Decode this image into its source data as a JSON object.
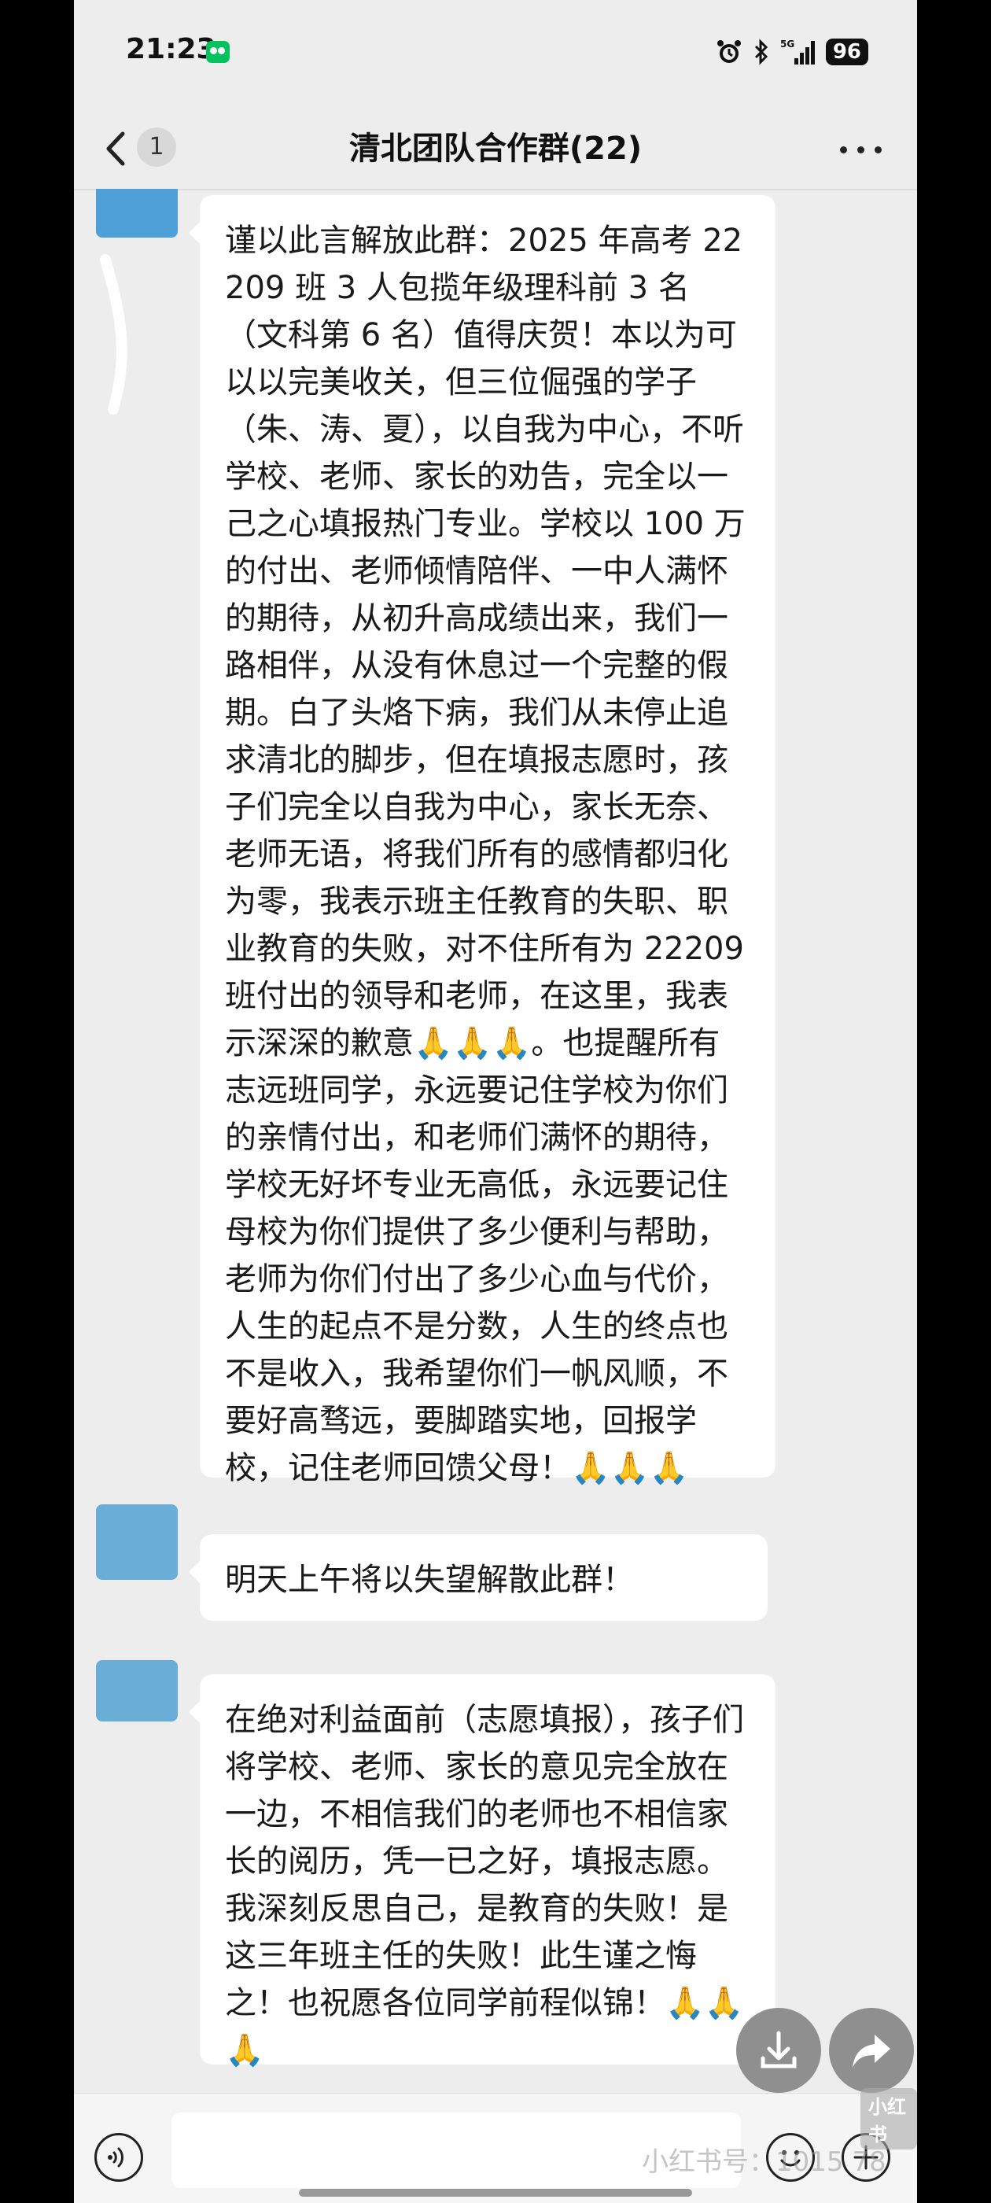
{
  "status_bar": {
    "time": "21:23",
    "network": "5G",
    "battery": "96",
    "icons": [
      "wechat-icon",
      "alarm-icon",
      "bluetooth-icon",
      "signal-icon",
      "battery-icon"
    ]
  },
  "nav": {
    "back_badge": "1",
    "title": "清北团队合作群(22)",
    "icons": [
      "back-icon",
      "more-icon"
    ]
  },
  "messages": [
    {
      "text": "谨以此言解放此群：2025 年高考 22209 班 3 人包揽年级理科前 3 名（文科第 6 名）值得庆贺！本以为可以以完美收关，但三位倔强的学子（朱、涛、夏），以自我为中心，不听学校、老师、家长的劝告，完全以一己之心填报热门专业。学校以 100 万的付出、老师倾情陪伴、一中人满怀的期待，从初升高成绩出来，我们一路相伴，从没有休息过一个完整的假期。白了头烙下病，我们从未停止追求清北的脚步，但在填报志愿时，孩子们完全以自我为中心，家长无奈、老师无语，将我们所有的感情都归化为零，我表示班主任教育的失职、职业教育的失败，对不住所有为 22209 班付出的领导和老师，在这里，我表示深深的歉意🙏🙏🙏。也提醒所有志远班同学，永远要记住学校为你们的亲情付出，和老师们满怀的期待，学校无好坏专业无高低，永远要记住母校为你们提供了多少便利与帮助，老师为你们付出了多少心血与代价，人生的起点不是分数，人生的终点也不是收入，我希望你们一帆风顺，不要好高骛远，要脚踏实地，回报学校，记住老师回馈父母！🙏🙏🙏"
    },
    {
      "text": "明天上午将以失望解散此群！"
    },
    {
      "text": "在绝对利益面前（志愿填报），孩子们将学校、老师、家长的意见完全放在一边，不相信我们的老师也不相信家长的阅历，凭一已之好，填报志愿。我深刻反思自己，是教育的失败！是这三年班主任的失败！此生谨之悔之！也祝愿各位同学前程似锦！🙏🙏🙏"
    }
  ],
  "floating_actions": [
    "download-icon",
    "share-icon"
  ],
  "input_bar": {
    "icons": [
      "voice-icon",
      "emoji-icon",
      "plus-icon"
    ]
  },
  "watermark": {
    "logo": "小红书",
    "text": "小红书号：1015 78"
  }
}
